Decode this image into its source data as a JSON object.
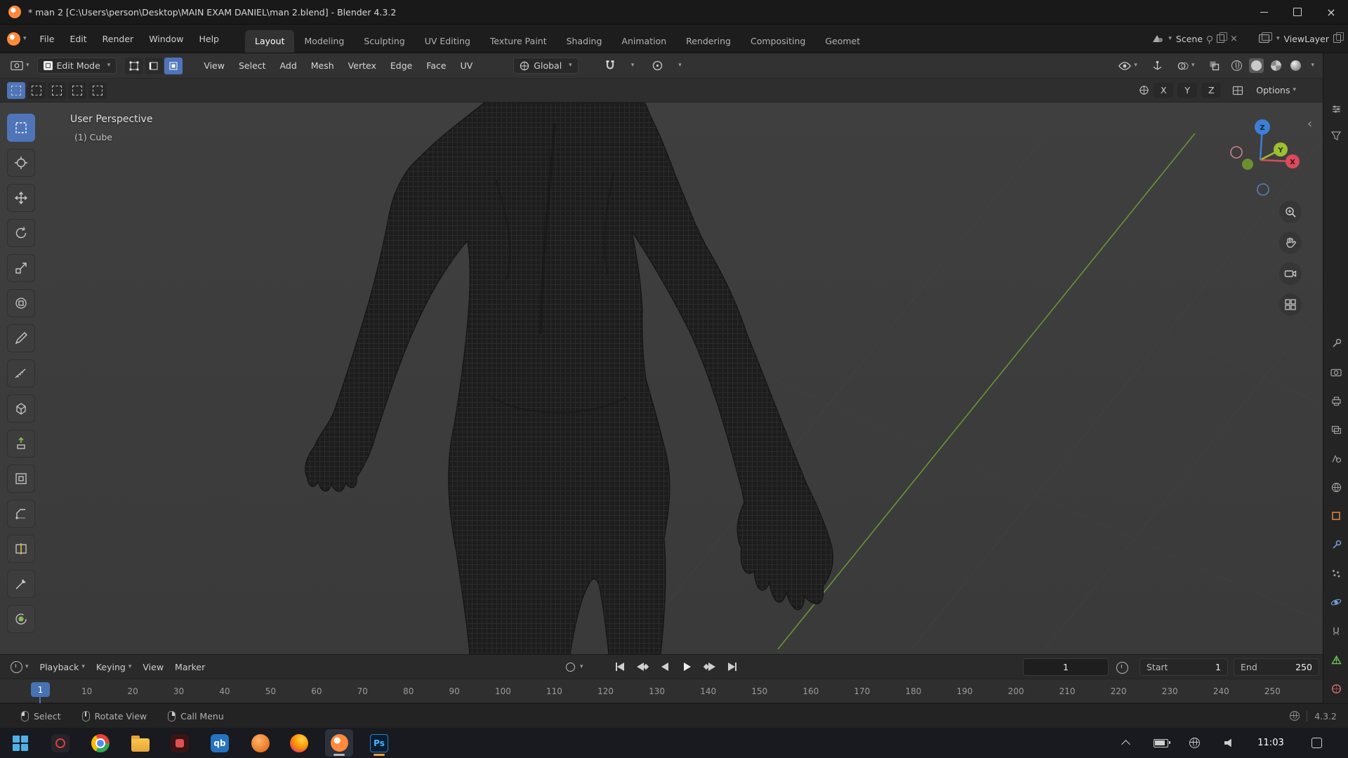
{
  "window": {
    "title": "* man 2 [C:\\Users\\person\\Desktop\\MAIN EXAM DANIEL\\man 2.blend] - Blender 4.3.2"
  },
  "glyphs": {
    "dropdown": "▾",
    "close": "×",
    "chevron_left": "‹"
  },
  "menubar": {
    "menus": [
      "File",
      "Edit",
      "Render",
      "Window",
      "Help"
    ],
    "workspaces": [
      "Layout",
      "Modeling",
      "Sculpting",
      "UV Editing",
      "Texture Paint",
      "Shading",
      "Animation",
      "Rendering",
      "Compositing",
      "Geomet"
    ],
    "scene": "Scene",
    "view_layer": "ViewLayer"
  },
  "tool_header": {
    "mode": "Edit Mode",
    "menus": [
      "View",
      "Select",
      "Add",
      "Mesh",
      "Vertex",
      "Edge",
      "Face",
      "UV"
    ],
    "orientation": "Global",
    "axes": [
      "X",
      "Y",
      "Z"
    ],
    "options_label": "Options"
  },
  "viewport": {
    "perspective_label": "User Perspective",
    "object_label": "(1) Cube"
  },
  "timeline": {
    "menus": [
      "Playback",
      "Keying",
      "View",
      "Marker"
    ],
    "current_frame": "1",
    "start_label": "Start",
    "start_value": "1",
    "end_label": "End",
    "end_value": "250",
    "ticks": [
      "10",
      "20",
      "30",
      "40",
      "50",
      "60",
      "70",
      "80",
      "90",
      "100",
      "110",
      "120",
      "130",
      "140",
      "150",
      "160",
      "170",
      "180",
      "190",
      "200",
      "210",
      "220",
      "230",
      "240",
      "250"
    ]
  },
  "status_bar": {
    "hints": [
      "Select",
      "Rotate View",
      "Call Menu"
    ],
    "version": "4.3.2"
  },
  "taskbar": {
    "time": "11:03",
    "qb_label": "qb",
    "ps_label": "Ps"
  },
  "colors": {
    "accent": "#4772b3",
    "axis_x": "#dd4a5c",
    "axis_y": "#9dc033",
    "axis_z": "#3d7fd6",
    "floor_axis_green": "#6f9d35"
  }
}
